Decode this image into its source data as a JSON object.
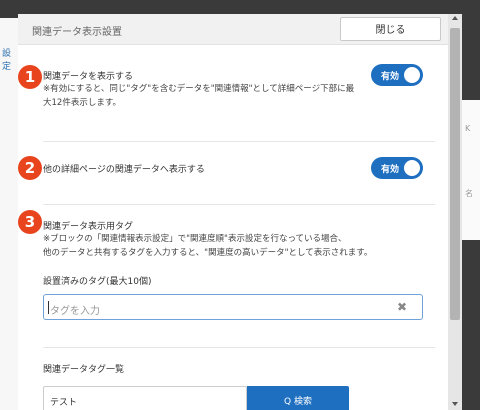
{
  "background": {
    "left_tab_text": "設定",
    "right_text_1": "K",
    "right_text_2": "名"
  },
  "dialog": {
    "title": "関連データ表示設置",
    "close_label": "閉じる"
  },
  "sections": [
    {
      "number": "1",
      "title": "関連データを表示する",
      "note_line1": "※有効にすると、同じ\"タグ\"を含むデータを\"関連情報\"として詳細ページ下部に最",
      "note_line2": "大12件表示します。",
      "toggle_label": "有効",
      "toggle_on": true
    },
    {
      "number": "2",
      "title": "他の詳細ページの関連データへ表示する",
      "toggle_label": "有効",
      "toggle_on": true
    },
    {
      "number": "3",
      "title": "関連データ表示用タグ",
      "note_line1": "※ブロックの「関連情報表示設定」で\"関連度順\"表示設定を行なっている場合、",
      "note_line2": "他のデータと共有するタグを入力すると、\"関連度の高いデータ\"として表示されます。",
      "tag_label": "設置済みのタグ(最大10個)",
      "tag_placeholder": "タグを入力",
      "clear_icon": "close-icon"
    }
  ],
  "tag_list": {
    "title": "関連データタグ一覧",
    "input_value": "テスト",
    "button_label": "Q 検索"
  },
  "colors": {
    "accent": "#1f6fc1",
    "badge": "#e8451f"
  }
}
